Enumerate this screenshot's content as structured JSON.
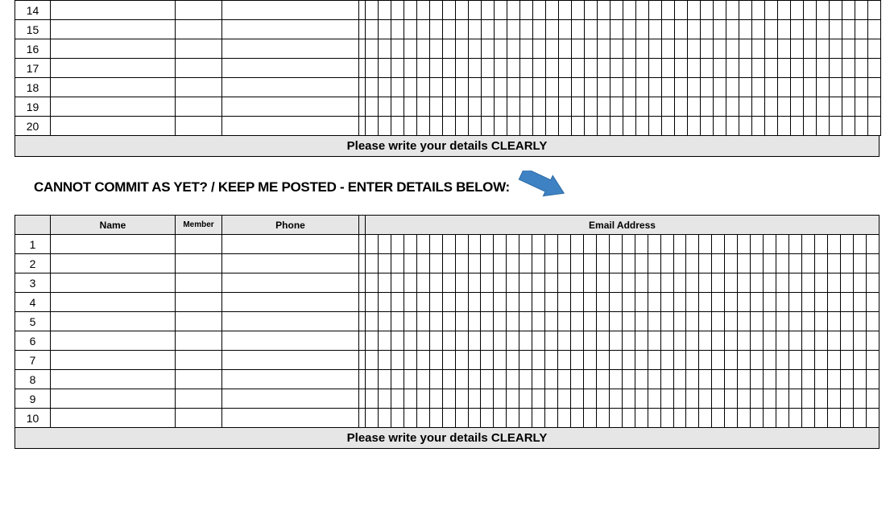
{
  "top_table": {
    "row_numbers": [
      "14",
      "15",
      "16",
      "17",
      "18",
      "19",
      "20"
    ],
    "email_cells_per_row": 40
  },
  "footer_message": "Please write your details CLEARLY",
  "heading_text": "CANNOT COMMIT AS YET? / KEEP ME POSTED - ENTER DETAILS BELOW:",
  "arrow_color": "#3e82c4",
  "bottom_table": {
    "headers": {
      "row_num": "",
      "name": "Name",
      "member": "Member",
      "phone": "Phone",
      "email": "Email Address"
    },
    "row_numbers": [
      "1",
      "2",
      "3",
      "4",
      "5",
      "6",
      "7",
      "8",
      "9",
      "10"
    ],
    "email_cells_per_row": 40
  }
}
